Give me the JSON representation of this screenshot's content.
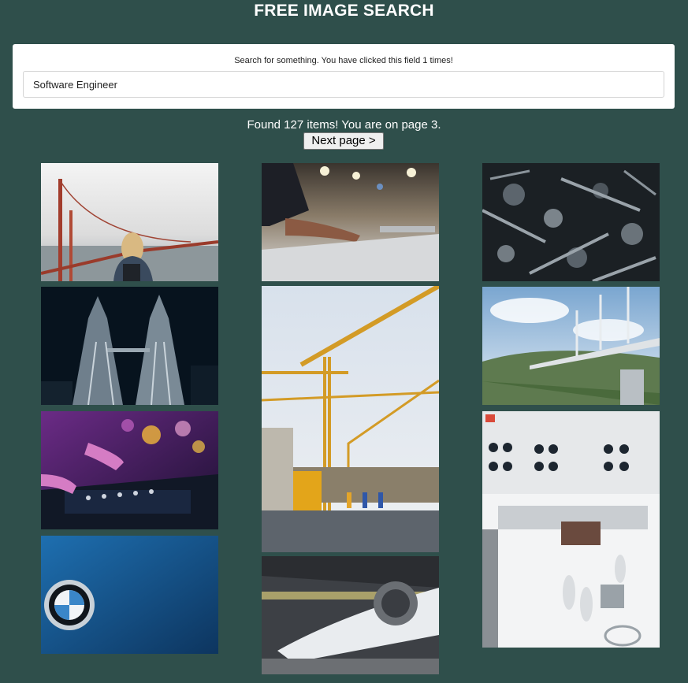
{
  "header": {
    "title": "FREE IMAGE SEARCH"
  },
  "search": {
    "label": "Search for something. You have clicked this field 1 times!",
    "value": "Software Engineer"
  },
  "results": {
    "status": "Found 127 items! You are on page 3.",
    "next_label": "Next page >"
  },
  "images": [
    {
      "subject": "woman-golden-gate-bridge",
      "column": 1
    },
    {
      "subject": "petronas-towers-night",
      "column": 1
    },
    {
      "subject": "dj-mixer-hands",
      "column": 1
    },
    {
      "subject": "bmw-logo-blue-car",
      "column": 1
    },
    {
      "subject": "hand-on-mixing-console",
      "column": 2
    },
    {
      "subject": "construction-cranes-site",
      "column": 2
    },
    {
      "subject": "rocket-in-hangar",
      "column": 2
    },
    {
      "subject": "metal-parts-pile",
      "column": 3
    },
    {
      "subject": "cable-stayed-viaduct",
      "column": 3
    },
    {
      "subject": "jpl-clean-room",
      "column": 3
    }
  ]
}
